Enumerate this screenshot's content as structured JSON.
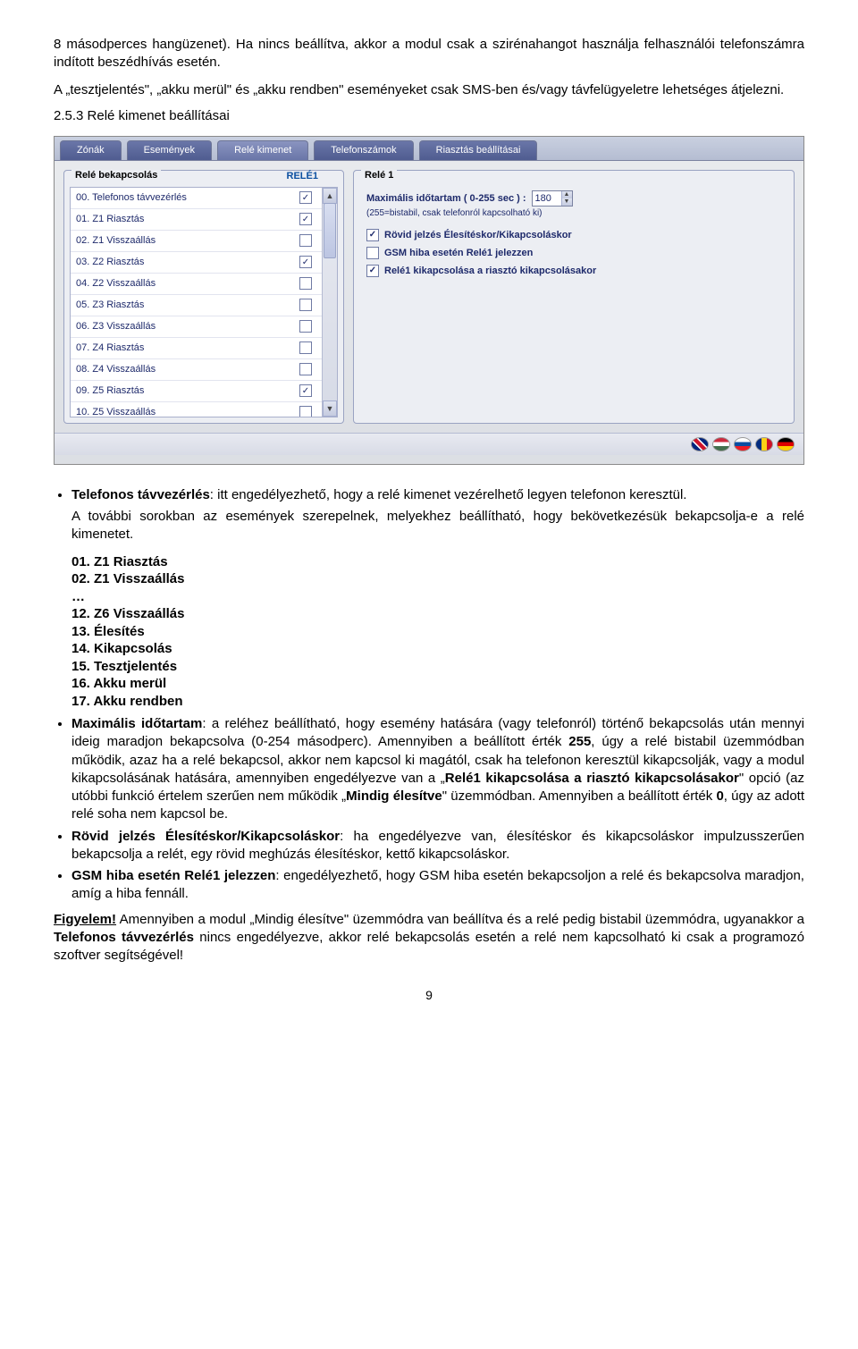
{
  "intro": {
    "p1": "8 másodperces hangüzenet). Ha nincs beállítva, akkor a modul csak a szirénahangot használja felhasználói telefonszámra indított beszédhívás esetén.",
    "p2": "A „tesztjelentés\", „akku merül\" és „akku rendben\" eseményeket csak SMS-ben és/vagy távfelügyeletre lehetséges átjelezni."
  },
  "section_heading": "2.5.3  Relé kimenet beállításai",
  "ui": {
    "tabs": [
      "Zónák",
      "Események",
      "Relé kimenet",
      "Telefonszámok",
      "Riasztás beállításai"
    ],
    "active_tab_index": 2,
    "left": {
      "legend": "Relé bekapcsolás",
      "column_label": "RELÉ1",
      "rows": [
        {
          "label": "00. Telefonos távvezérlés",
          "checked": true
        },
        {
          "label": "01. Z1 Riasztás",
          "checked": true
        },
        {
          "label": "02. Z1 Visszaállás",
          "checked": false
        },
        {
          "label": "03. Z2 Riasztás",
          "checked": true
        },
        {
          "label": "04. Z2 Visszaállás",
          "checked": false
        },
        {
          "label": "05. Z3 Riasztás",
          "checked": false
        },
        {
          "label": "06. Z3 Visszaállás",
          "checked": false
        },
        {
          "label": "07. Z4 Riasztás",
          "checked": false
        },
        {
          "label": "08. Z4 Visszaállás",
          "checked": false
        },
        {
          "label": "09. Z5 Riasztás",
          "checked": true
        },
        {
          "label": "10. Z5 Visszaállás",
          "checked": false
        }
      ]
    },
    "right": {
      "legend": "Relé 1",
      "max_label_a": "Maximális időtartam ( 0-255 sec ) :",
      "max_value": "180",
      "sub_note": "(255=bistabil, csak telefonról kapcsolható ki)",
      "opts": [
        {
          "label": "Rövid jelzés Élesítéskor/Kikapcsoláskor",
          "checked": true
        },
        {
          "label": "GSM hiba esetén Relé1 jelezzen",
          "checked": false
        },
        {
          "label": "Relé1 kikapcsolása a riasztó kikapcsolásakor",
          "checked": true
        }
      ]
    }
  },
  "body": {
    "b1_prefix": "Telefonos távvezérlés",
    "b1_text": ": itt engedélyezhető, hogy a relé kimenet vezérelhető legyen telefonon keresztül.",
    "b1_cont": "A további sorokban az események szerepelnek, melyekhez beállítható, hogy bekövetkezésük bekapcsolja-e a relé kimenetet.",
    "list": [
      "01. Z1 Riasztás",
      "02. Z1 Visszaállás",
      "…",
      "12. Z6 Visszaállás",
      "13. Élesítés",
      "14. Kikapcsolás",
      "15. Tesztjelentés",
      "16. Akku merül",
      "17. Akku rendben"
    ],
    "b2_prefix": "Maximális időtartam",
    "b2_text": ": a reléhez beállítható, hogy esemény hatására (vagy telefonról) történő bekapcsolás után mennyi ideig maradjon bekapcsolva (0-254 másodperc). Amennyiben a beállított érték ",
    "b2_bold255": "255",
    "b2_after255": ", úgy a relé bistabil üzemmódban működik, azaz ha a relé bekapcsol, akkor nem kapcsol ki magától, csak ha telefonon keresztül kikapcsolják, vagy a modul kikapcsolásának hatására, amennyiben engedélyezve van a „",
    "b2_boldopt": "Relé1 kikapcsolása a riasztó kikapcsolásakor",
    "b2_afteropt": "\" opció (az utóbbi funkció értelem szerűen nem működik „",
    "b2_boldmode": "Mindig élesítve",
    "b2_aftermode": "\" üzemmódban. Amennyiben a beállított érték ",
    "b2_bold0": "0",
    "b2_after0": ", úgy az adott relé soha nem kapcsol be.",
    "b3_prefix": "Rövid jelzés Élesítéskor/Kikapcsoláskor",
    "b3_text": ": ha engedélyezve van, élesítéskor és kikapcsoláskor impulzusszerűen bekapcsolja a relét, egy rövid meghúzás élesítéskor, kettő kikapcsoláskor.",
    "b4_prefix": "GSM hiba esetén Relé1 jelezzen",
    "b4_text": ": engedélyezhető, hogy GSM hiba esetén bekapcsoljon a relé és bekapcsolva maradjon, amíg a hiba fennáll.",
    "warn_prefix": "Figyelem!",
    "warn_text": " Amennyiben a modul „Mindig élesítve\" üzemmódra van beállítva és a relé pedig bistabil üzemmódra, ugyanakkor a ",
    "warn_bold": "Telefonos távvezérlés",
    "warn_after": " nincs engedélyezve, akkor relé bekapcsolás esetén a relé nem kapcsolható ki csak a programozó szoftver segítségével!"
  },
  "page_number": "9"
}
